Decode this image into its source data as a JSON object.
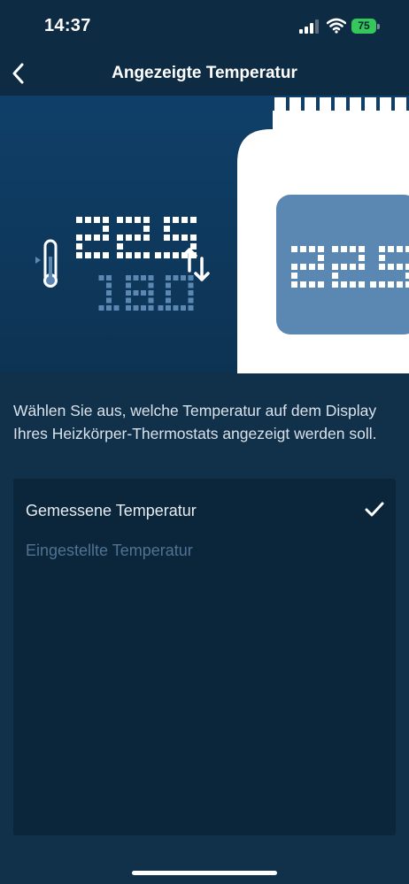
{
  "status_bar": {
    "time": "14:37",
    "battery": "75"
  },
  "nav": {
    "title": "Angezeigte Temperatur",
    "back_icon": "chevron-left-icon"
  },
  "illustration": {
    "primary_reading": "22.5",
    "secondary_reading": "18.0",
    "device_reading": "22.5",
    "colors": {
      "white": "#ffffff",
      "blue": "#5b87b3",
      "device_screen": "#5b87b3"
    }
  },
  "description": "Wählen Sie aus, welche Temperatur auf dem Display Ihres Heizkörper-Thermostats angezeigt werden soll.",
  "options": [
    {
      "label": "Gemessene Temperatur",
      "selected": true
    },
    {
      "label": "Eingestellte Temperatur",
      "selected": false
    }
  ],
  "colors": {
    "background": "#11304a",
    "panel": "#0b253a",
    "accent": "#5b87b3"
  }
}
